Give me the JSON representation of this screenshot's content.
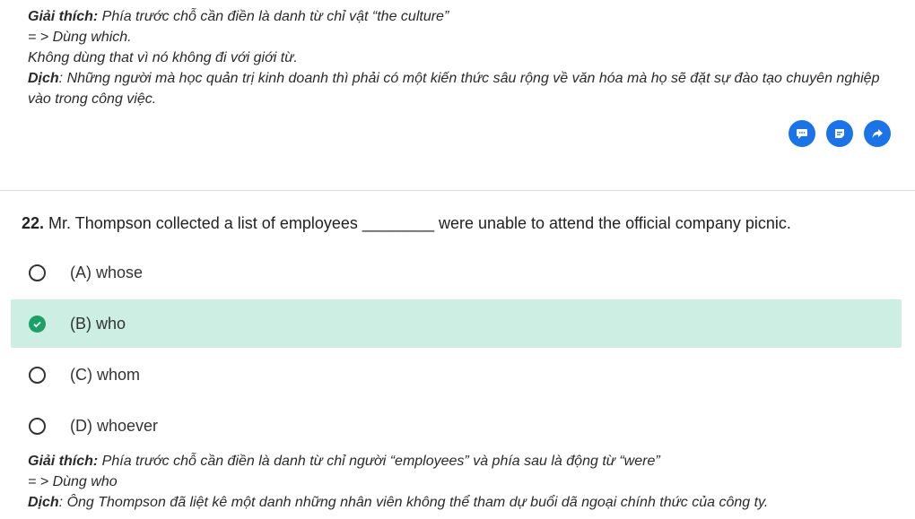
{
  "explanation_prev": {
    "line1_label": "Giải thích:",
    "line1_text": " Phía trước chỗ cần điền là danh từ chỉ vật “the culture”",
    "line2": "= > Dùng which.",
    "line3": "Không dùng that vì nó không đi với giới từ.",
    "line4_label": "Dịch",
    "line4_text": ": Những người mà học quản trị kinh doanh thì phải có một kiến thức sâu rộng về văn hóa mà họ sẽ đặt sự đào tạo chuyên nghiệp vào trong công việc."
  },
  "actions": {
    "comment_icon": "comment-icon",
    "note_icon": "note-icon",
    "share_icon": "share-icon",
    "color": "#1a73e8"
  },
  "question": {
    "number": "22.",
    "text": " Mr. Thompson collected a list of employees ________ were unable to attend the official company picnic."
  },
  "options": [
    {
      "label": "(A) whose",
      "state": "unselected"
    },
    {
      "label": "(B) who",
      "state": "correct"
    },
    {
      "label": "(C) whom",
      "state": "unselected"
    },
    {
      "label": "(D) whoever",
      "state": "unselected"
    }
  ],
  "colors": {
    "correct_bg": "#cdeee3",
    "correct_check": "#1aa266"
  },
  "explanation": {
    "line1_label": "Giải thích:",
    "line1_text": " Phía trước chỗ cần điền là danh từ chỉ người “employees” và phía sau là động từ “were”",
    "line2": "= > Dùng who",
    "line3_label": "Dịch",
    "line3_text": ": Ông Thompson đã liệt kê một danh những nhân viên không thể tham dự buổi dã ngoại chính thức của công ty."
  }
}
